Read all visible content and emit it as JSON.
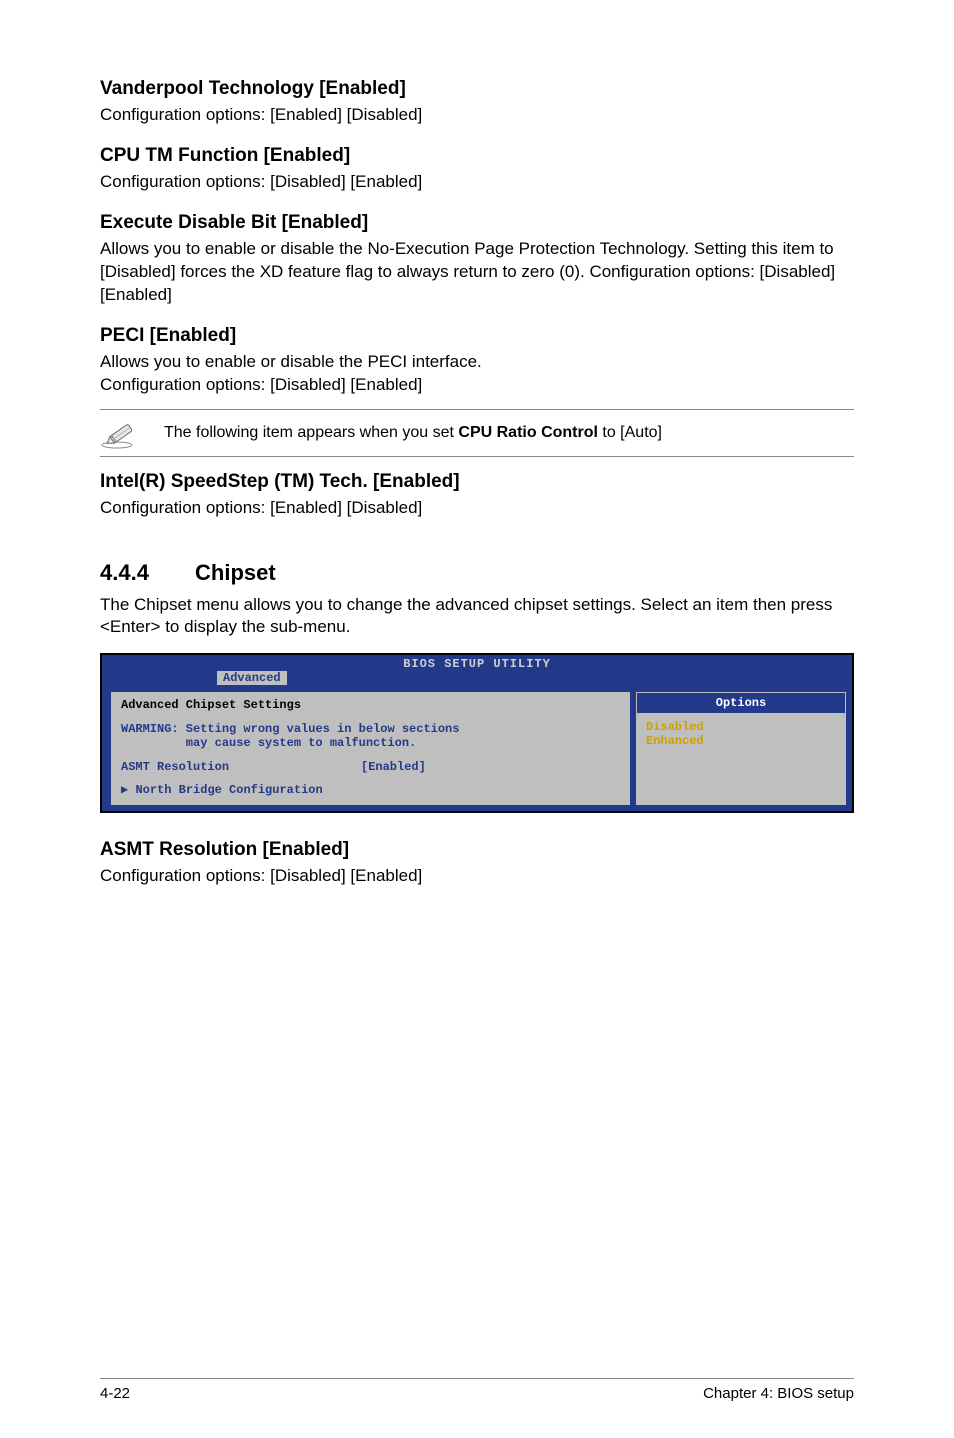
{
  "s1": {
    "h": "Vanderpool Technology [Enabled]",
    "p": "Configuration options: [Enabled] [Disabled]"
  },
  "s2": {
    "h": "CPU TM Function [Enabled]",
    "p": "Configuration options: [Disabled] [Enabled]"
  },
  "s3": {
    "h": "Execute Disable Bit [Enabled]",
    "p": "Allows you to enable or disable the No-Execution Page Protection Technology. Setting this item to [Disabled] forces the XD feature flag to always return to zero (0). Configuration options: [Disabled] [Enabled]"
  },
  "s4": {
    "h": "PECI [Enabled]",
    "p1": "Allows you to enable or disable the PECI interface.",
    "p2": "Configuration options: [Disabled] [Enabled]"
  },
  "note": {
    "pre": "The following item appears when you set ",
    "bold": "CPU Ratio Control",
    "post": " to [Auto]"
  },
  "s5": {
    "h": "Intel(R) SpeedStep (TM) Tech. [Enabled]",
    "p": "Configuration options: [Enabled] [Disabled]"
  },
  "sec": {
    "num": "4.4.4",
    "title": "Chipset",
    "intro": "The Chipset menu allows you to change the advanced chipset settings. Select an item then press <Enter> to display the sub-menu."
  },
  "bios": {
    "title": "BIOS SETUP UTILITY",
    "tab": "Advanced",
    "left_title": "Advanced Chipset Settings",
    "warn": "WARMING: Setting wrong values in below sections\n         may cause system to malfunction.",
    "row1_k": "ASMT Resolution",
    "row1_v": "[Enabled]",
    "sub": "North Bridge Configuration",
    "opt_title": "Options",
    "opt1": "Disabled",
    "opt2": "Enhanced"
  },
  "s6": {
    "h": "ASMT Resolution [Enabled]",
    "p": "Configuration options: [Disabled] [Enabled]"
  },
  "footer": {
    "left": "4-22",
    "right": "Chapter 4: BIOS setup"
  }
}
